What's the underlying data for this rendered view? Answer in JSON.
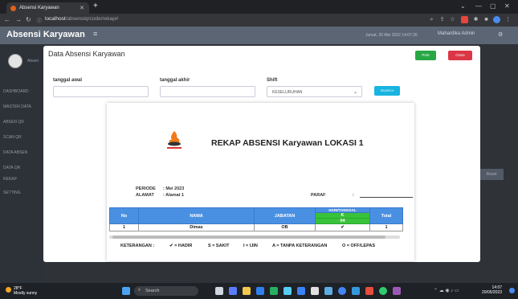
{
  "browser": {
    "tab_title": "Absensi Karyawan",
    "url_host": "localhost",
    "url_path": "/absensiqrcode/rekap#"
  },
  "app": {
    "brand": "Absensi Karyawan",
    "header_date": "Jumat, 20 Mei 2022 14:07:26",
    "header_user": "Mahardika Admin"
  },
  "sidebar": {
    "user_label": "Absen",
    "items": [
      "DASHBOARD",
      "MASTER DATA",
      "ABSEN QR",
      "SCAN QR",
      "DATA ABSEN",
      "DATA QR",
      "REKAP",
      "SETTING"
    ]
  },
  "modal": {
    "title": "Data Absensi Karyawan",
    "print_label": "Print",
    "close_label": "Close",
    "filters": {
      "start_label": "tanggal awal",
      "end_label": "tanggal akhir",
      "shift_label": "Shift",
      "shift_value": "KESELURUHAN",
      "search_label": "SEARCH"
    }
  },
  "report": {
    "logo_text": "KARYAWAN GAMAS",
    "title": "REKAP ABSENSI Karyawan LOKASI 1",
    "periode_label": "PERIODE",
    "periode_value": ": Mei 2023",
    "alamat_label": "ALAMAT",
    "alamat_value": ": Alamat 1",
    "paraf_label": "PARAF",
    "paraf_sep": ":",
    "table": {
      "headers": {
        "no": "No",
        "nama": "NAMA",
        "jabatan": "JABATAN",
        "hari": "HARI/TANGGAL",
        "day_code": "K",
        "day_num": "04",
        "total": "Total"
      },
      "rows": [
        {
          "no": "1",
          "nama": "Dimas",
          "jabatan": "OB",
          "status": "✔",
          "total": "1"
        }
      ]
    },
    "legend": {
      "title": "KETERANGAN :",
      "hadir": "✔ = HADIR",
      "sakit": "S = SAKIT",
      "ijin": "I = IJIN",
      "tk": "A = TANPA KETERANGAN",
      "off": "O = OFF/LEPAS"
    }
  },
  "taskbar": {
    "weather_temp": "28°F",
    "weather_desc": "Mostly sunny",
    "search_placeholder": "Search",
    "time": "14:07",
    "date": "20/05/2023"
  },
  "colors": {
    "header_blue": "#4a90e2",
    "today_green": "#38c33a",
    "print_green": "#28a745",
    "close_red": "#dc3545",
    "search_cyan": "#17b4e0"
  }
}
